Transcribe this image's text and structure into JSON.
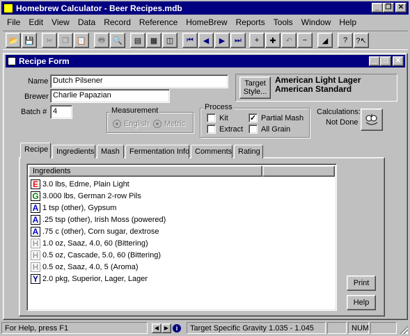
{
  "app": {
    "title": "Homebrew Calculator - Beer Recipes.mdb"
  },
  "menu": [
    "File",
    "Edit",
    "View",
    "Data",
    "Record",
    "Reference",
    "HomeBrew",
    "Reports",
    "Tools",
    "Window",
    "Help"
  ],
  "toolbar": {
    "icons": [
      "open-folder-icon",
      "save-icon",
      "cut-icon",
      "copy-icon",
      "paste-icon",
      "print-icon",
      "print-preview-icon",
      "form-view-icon",
      "datasheet-view-icon",
      "database-window-icon",
      "first-record-icon",
      "previous-record-icon",
      "next-record-icon",
      "last-record-icon",
      "new-record-icon",
      "add-plus-icon",
      "undo-icon",
      "delete-record-icon",
      "design-icon",
      "help-icon",
      "whats-this-help-icon"
    ]
  },
  "form": {
    "title": "Recipe Form",
    "name_label": "Name",
    "name_value": "Dutch Pilsener",
    "brewer_label": "Brewer",
    "brewer_value": "Charlie Papazian",
    "batch_label": "Batch #",
    "batch_value": "4",
    "target_style_button": "Target Style...",
    "style_category": "American Light Lager",
    "style_name": "American Standard",
    "measurement": {
      "label": "Measurement",
      "english": "English",
      "metric": "Metric"
    },
    "process": {
      "label": "Process",
      "kit": "Kit",
      "extract": "Extract",
      "partial_mash": "Partial Mash",
      "all_grain": "All Grain",
      "kit_checked": false,
      "extract_checked": false,
      "partial_mash_checked": true,
      "all_grain_checked": false
    },
    "calculations_label": "Calculations:",
    "calculations_value": "Not Done",
    "tabs": [
      "Recipe",
      "Ingredients",
      "Mash",
      "Fermentation Info",
      "Comments",
      "Rating"
    ],
    "active_tab": "Recipe",
    "ingredients_header": "Ingredients",
    "ingredients": [
      {
        "badge": "E",
        "color": "#ff0000",
        "text": "3.0 lbs, Edme, Plain Light"
      },
      {
        "badge": "G",
        "color": "#008000",
        "text": "3.000 lbs, German 2-row Pils"
      },
      {
        "badge": "A",
        "color": "#0000c0",
        "text": "1 tsp (other), Gypsum"
      },
      {
        "badge": "A",
        "color": "#0000c0",
        "text": ".25 tsp (other), Irish Moss (powered)"
      },
      {
        "badge": "A",
        "color": "#0000c0",
        "text": ".75 c (other), Corn sugar, dextrose"
      },
      {
        "badge": "H",
        "color": "#a0a0a0",
        "text": "1.0 oz, Saaz, 4.0, 60 (Bittering)"
      },
      {
        "badge": "H",
        "color": "#a0a0a0",
        "text": "0.5 oz, Cascade, 5.0, 60 (Bittering)"
      },
      {
        "badge": "H",
        "color": "#a0a0a0",
        "text": "0.5 oz, Saaz, 4.0, 5 (Aroma)"
      },
      {
        "badge": "Y",
        "color": "#000080",
        "text": "2.0 pkg, Superior, Lager, Lager"
      }
    ],
    "print_button": "Print",
    "help_button": "Help"
  },
  "status": {
    "help": "For Help, press F1",
    "message": "Target Specific Gravity 1.035 - 1.045",
    "num": "NUM"
  }
}
